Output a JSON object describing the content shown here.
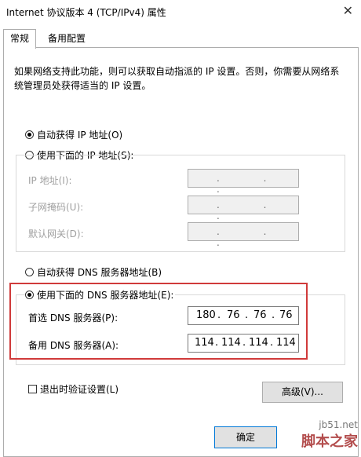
{
  "window": {
    "title": "Internet 协议版本 4 (TCP/IPv4) 属性"
  },
  "tabs": [
    {
      "label": "常规"
    },
    {
      "label": "备用配置"
    }
  ],
  "description": "如果网络支持此功能，则可以获取自动指派的 IP 设置。否则，你需要从网络系统管理员处获得适当的 IP 设置。",
  "ip_section": {
    "auto_radio": {
      "label": "自动获得 IP 地址(O)",
      "checked": true
    },
    "manual_radio": {
      "label": "使用下面的 IP 地址(S):",
      "checked": false
    },
    "fields": [
      {
        "label": "IP 地址(I):",
        "value": ". . ."
      },
      {
        "label": "子网掩码(U):",
        "value": ". . ."
      },
      {
        "label": "默认网关(D):",
        "value": ". . ."
      }
    ]
  },
  "dns_section": {
    "auto_radio": {
      "label": "自动获得 DNS 服务器地址(B)",
      "checked": false
    },
    "manual_radio": {
      "label": "使用下面的 DNS 服务器地址(E):",
      "checked": true
    },
    "preferred": {
      "label": "首选 DNS 服务器(P):",
      "octets": [
        "180",
        "76",
        "76",
        "76"
      ]
    },
    "alternate": {
      "label": "备用 DNS 服务器(A):",
      "octets": [
        "114",
        "114",
        "114",
        "114"
      ]
    }
  },
  "validate_checkbox": {
    "label": "退出时验证设置(L)",
    "checked": false
  },
  "buttons": {
    "advanced": "高级(V)...",
    "ok": "确定"
  },
  "watermark": {
    "url": "jb51.net",
    "name": "脚本之家"
  },
  "colors": {
    "highlight_border": "#d03a3a",
    "accent": "#0078d7"
  }
}
